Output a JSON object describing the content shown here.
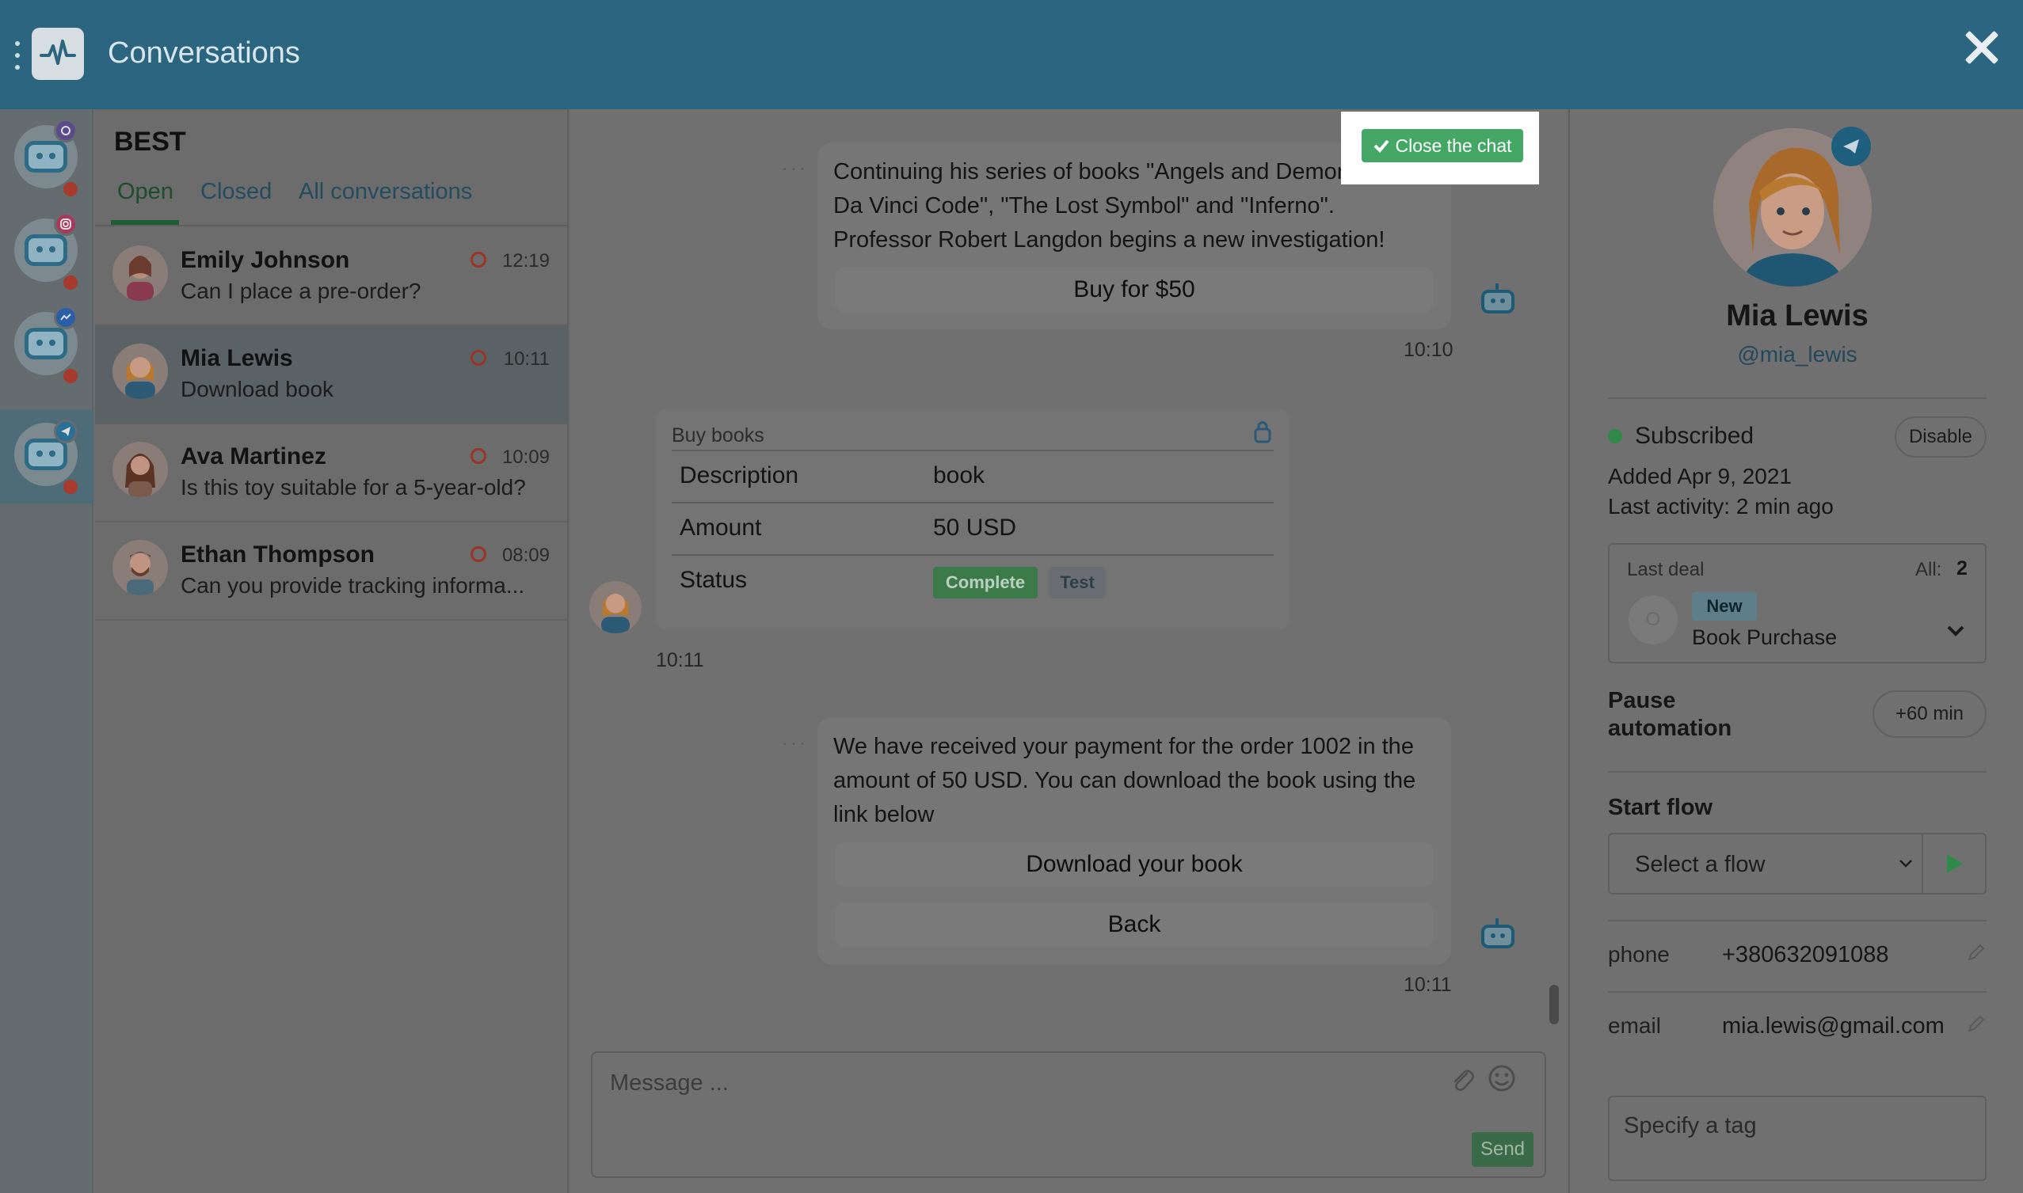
{
  "header": {
    "title": "Conversations"
  },
  "bots": [
    {
      "channel": "viber",
      "color": "#5b4a8a"
    },
    {
      "channel": "instagram",
      "color": "#a83a5e"
    },
    {
      "channel": "messenger",
      "color": "#2a5fa8"
    },
    {
      "channel": "telegram",
      "color": "#2a6f95"
    }
  ],
  "conversations": {
    "bot_name": "BEST",
    "tabs": [
      "Open",
      "Closed",
      "All conversations"
    ],
    "items": [
      {
        "name": "Emily Johnson",
        "message": "Can I place a pre-order?",
        "time": "12:19"
      },
      {
        "name": "Mia Lewis",
        "message": "Download book",
        "time": "10:11"
      },
      {
        "name": "Ava Martinez",
        "message": "Is this toy suitable for a 5-year-old?",
        "time": "10:09"
      },
      {
        "name": "Ethan Thompson",
        "message": "Can you provide tracking informa...",
        "time": "08:09"
      }
    ]
  },
  "chat": {
    "close_chat_label": "Close the chat",
    "messages": [
      {
        "text": "Continuing his series of books \"Angels and Demons\", \"The Da Vinci Code\", \"The Lost Symbol\" and \"Inferno\". Professor Robert Langdon begins a new investigation!",
        "buttons": [
          "Buy for $50"
        ],
        "time": "10:10"
      },
      {
        "text": "We have received your payment for the order 1002 in the amount of 50 USD. You can download the book using the link below",
        "buttons": [
          "Download your book",
          "Back"
        ],
        "time": "10:11"
      }
    ],
    "order_card": {
      "title": "Buy books",
      "rows": [
        {
          "label": "Description",
          "value": "book"
        },
        {
          "label": "Amount",
          "value": "50 USD"
        },
        {
          "label": "Status",
          "badges": [
            "Complete",
            "Test"
          ]
        }
      ],
      "time": "10:11"
    },
    "composer": {
      "placeholder": "Message ...",
      "send_label": "Send"
    }
  },
  "profile": {
    "name": "Mia Lewis",
    "handle": "@mia_lewis",
    "status": "Subscribed",
    "disable_label": "Disable",
    "added": "Added Apr 9, 2021",
    "last_activity": "Last activity: 2 min ago",
    "last_deal": {
      "label": "Last deal",
      "all_label": "All:",
      "all_count": "2",
      "avatar_letter": "O",
      "badge": "New",
      "title": "Book Purchase"
    },
    "pause_automation": "Pause automation",
    "pause_button": "+60 min",
    "start_flow_label": "Start flow",
    "flow_placeholder": "Select a flow",
    "fields": [
      {
        "label": "phone",
        "value": "+380632091088"
      },
      {
        "label": "email",
        "value": "mia.lewis@gmail.com"
      }
    ],
    "tag_placeholder": "Specify a tag"
  },
  "colors": {
    "header": "#2c6580",
    "accent_green": "#44a766",
    "status_ring": "#9a3426"
  }
}
